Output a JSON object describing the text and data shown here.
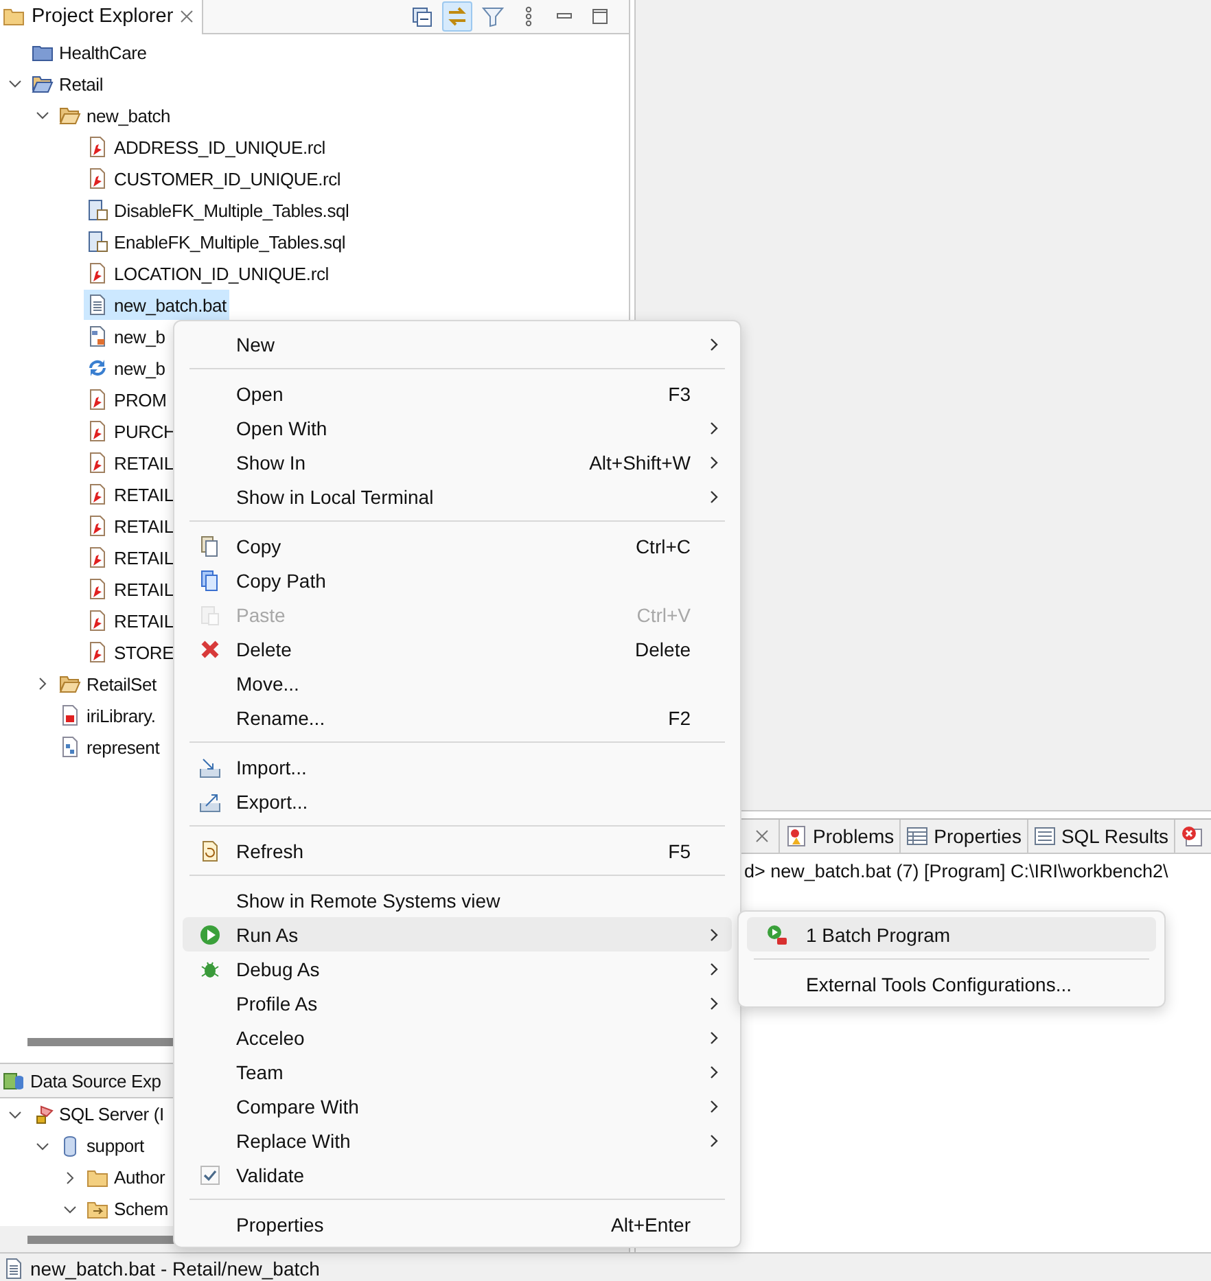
{
  "explorer": {
    "title": "Project Explorer",
    "toolbar": [
      {
        "kind": "collapse",
        "on": false
      },
      {
        "kind": "link",
        "on": true
      },
      {
        "kind": "filter",
        "on": false
      }
    ],
    "tree": [
      {
        "label": "HealthCare",
        "kind": "project",
        "selected": false
      },
      {
        "label": "Retail",
        "kind": "project-open",
        "selected": false,
        "expanded": true,
        "children": [
          {
            "label": "new_batch",
            "kind": "folder-open",
            "selected": false,
            "expanded": true,
            "children": [
              {
                "label": "ADDRESS_ID_UNIQUE.rcl",
                "kind": "rcl",
                "selected": false
              },
              {
                "label": "CUSTOMER_ID_UNIQUE.rcl",
                "kind": "rcl",
                "selected": false
              },
              {
                "label": "DisableFK_Multiple_Tables.sql",
                "kind": "sql",
                "selected": false
              },
              {
                "label": "EnableFK_Multiple_Tables.sql",
                "kind": "sql",
                "selected": false
              },
              {
                "label": "LOCATION_ID_UNIQUE.rcl",
                "kind": "rcl",
                "selected": false
              },
              {
                "label": "new_batch.bat",
                "kind": "text",
                "selected": true
              },
              {
                "label": "new_b",
                "kind": "flow",
                "selected": false
              },
              {
                "label": "new_b",
                "kind": "sync",
                "selected": false
              },
              {
                "label": "PROM",
                "kind": "rcl",
                "selected": false
              },
              {
                "label": "PURCH",
                "kind": "rcl",
                "selected": false
              },
              {
                "label": "RETAIL",
                "kind": "rcl",
                "selected": false
              },
              {
                "label": "RETAIL",
                "kind": "rcl",
                "selected": false
              },
              {
                "label": "RETAIL",
                "kind": "rcl",
                "selected": false
              },
              {
                "label": "RETAIL",
                "kind": "rcl",
                "selected": false
              },
              {
                "label": "RETAIL",
                "kind": "rcl",
                "selected": false
              },
              {
                "label": "RETAIL",
                "kind": "rcl",
                "selected": false
              },
              {
                "label": "STORE",
                "kind": "rcl",
                "selected": false
              }
            ]
          },
          {
            "label": "RetailSet",
            "kind": "folder-open",
            "selected": false,
            "expanded": false
          },
          {
            "label": "iriLibrary.",
            "kind": "library",
            "selected": false
          },
          {
            "label": "represent",
            "kind": "diagram",
            "selected": false
          }
        ]
      }
    ]
  },
  "data_source": {
    "title": "Data Source Exp",
    "tree": [
      {
        "label": "SQL Server (I",
        "kind": "server",
        "selected": false,
        "expanded": true,
        "children": [
          {
            "label": "support",
            "kind": "database",
            "selected": false,
            "expanded": true,
            "children": [
              {
                "label": "Author",
                "kind": "folder",
                "selected": false,
                "expanded": false
              },
              {
                "label": "Schem",
                "kind": "schema",
                "selected": false,
                "expanded": true
              }
            ]
          }
        ]
      }
    ]
  },
  "console": {
    "tabs": [
      {
        "label": "Problems",
        "kind": "problems",
        "selected": false
      },
      {
        "label": "Properties",
        "kind": "properties",
        "selected": false
      },
      {
        "label": "SQL Results",
        "kind": "results",
        "selected": false
      },
      {
        "kind": "error",
        "selected": false
      }
    ],
    "line": "d> new_batch.bat (7) [Program] C:\\IRI\\workbench2\\"
  },
  "menu": {
    "items": [
      {
        "label": "New",
        "submenu": true,
        "selected": false
      },
      {
        "kind": "separator"
      },
      {
        "label": "Open",
        "shortcut": "F3",
        "selected": false
      },
      {
        "label": "Open With",
        "submenu": true,
        "selected": false
      },
      {
        "label": "Show In",
        "shortcut": "Alt+Shift+W",
        "submenu": true,
        "selected": false
      },
      {
        "label": "Show in Local Terminal",
        "submenu": true,
        "selected": false
      },
      {
        "kind": "separator"
      },
      {
        "label": "Copy",
        "kind": "copy",
        "shortcut": "Ctrl+C",
        "selected": false
      },
      {
        "label": "Copy Path",
        "kind": "copy-path",
        "selected": false
      },
      {
        "label": "Paste",
        "kind": "paste",
        "shortcut": "Ctrl+V",
        "disabled": true,
        "selected": false
      },
      {
        "label": "Delete",
        "kind": "delete",
        "shortcut": "Delete",
        "selected": false
      },
      {
        "label": "Move...",
        "selected": false
      },
      {
        "label": "Rename...",
        "shortcut": "F2",
        "selected": false
      },
      {
        "kind": "separator"
      },
      {
        "label": "Import...",
        "kind": "import",
        "selected": false
      },
      {
        "label": "Export...",
        "kind": "export",
        "selected": false
      },
      {
        "kind": "separator"
      },
      {
        "label": "Refresh",
        "kind": "refresh",
        "shortcut": "F5",
        "selected": false
      },
      {
        "kind": "separator"
      },
      {
        "label": "Show in Remote Systems view",
        "selected": false
      },
      {
        "label": "Run As",
        "kind": "run",
        "submenu": true,
        "selected": true
      },
      {
        "label": "Debug As",
        "kind": "debug",
        "submenu": true,
        "selected": false
      },
      {
        "label": "Profile As",
        "submenu": true,
        "selected": false
      },
      {
        "label": "Acceleo",
        "submenu": true,
        "selected": false
      },
      {
        "label": "Team",
        "submenu": true,
        "selected": false
      },
      {
        "label": "Compare With",
        "submenu": true,
        "selected": false
      },
      {
        "label": "Replace With",
        "submenu": true,
        "selected": false
      },
      {
        "label": "Validate",
        "kind": "check",
        "checked": true,
        "selected": false
      },
      {
        "kind": "separator"
      },
      {
        "label": "Properties",
        "shortcut": "Alt+Enter",
        "selected": false
      }
    ]
  },
  "submenu": {
    "items": [
      {
        "label": "1 Batch Program",
        "kind": "batch",
        "selected": true
      },
      {
        "kind": "separator"
      },
      {
        "label": "External Tools Configurations...",
        "selected": false
      }
    ]
  },
  "status_bar": {
    "text": "new_batch.bat - Retail/new_batch"
  }
}
